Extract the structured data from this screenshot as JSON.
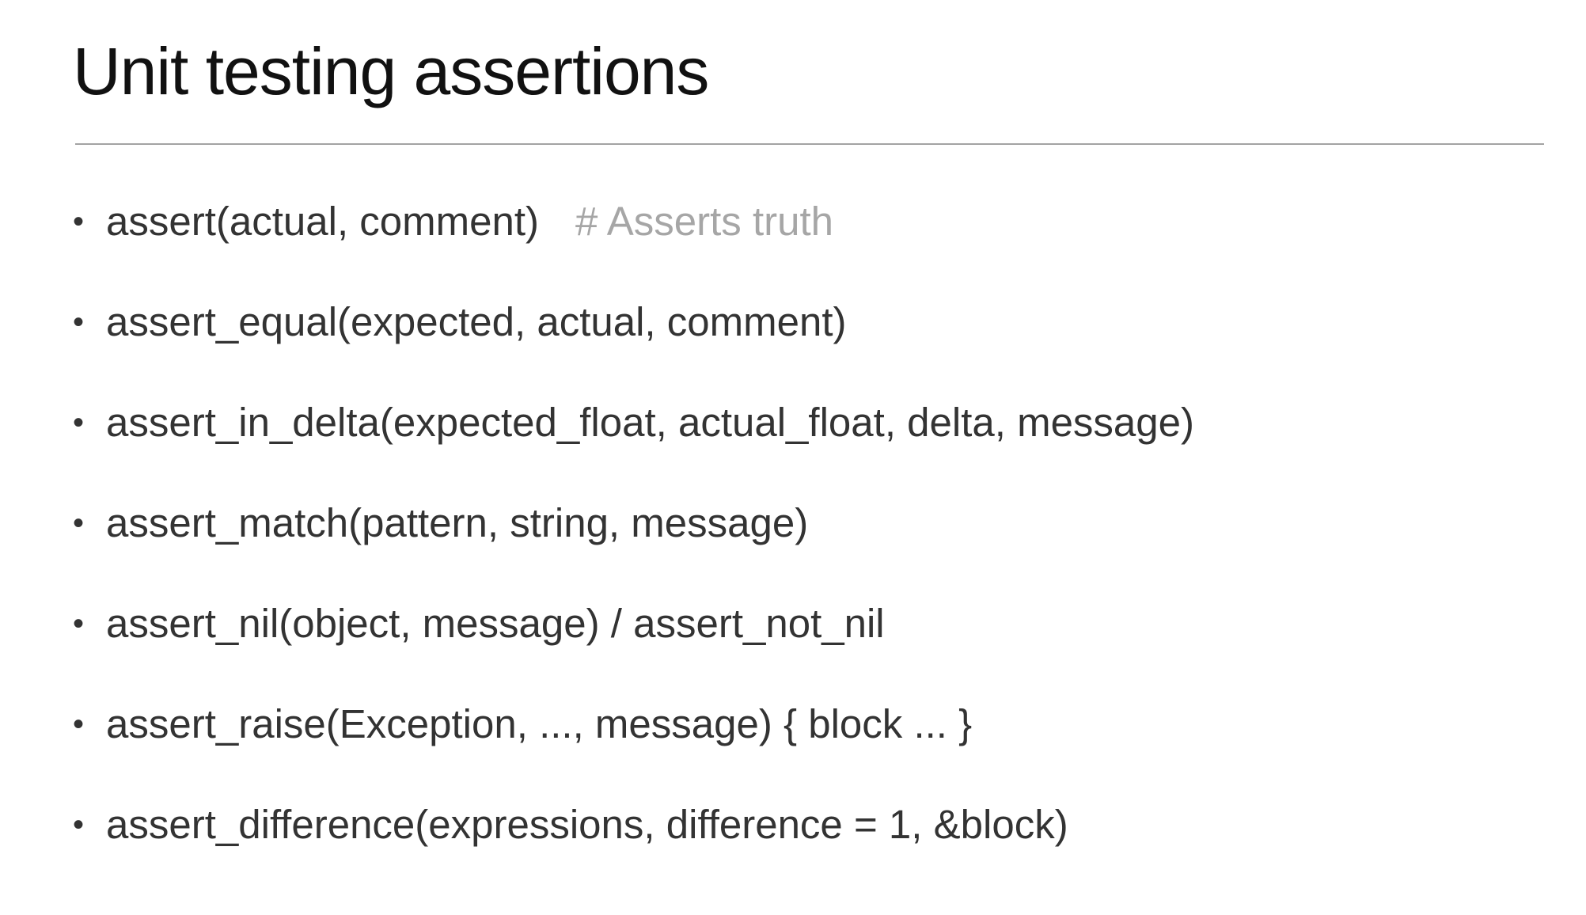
{
  "slide": {
    "title": "Unit testing assertions",
    "bullets": [
      {
        "text": "assert(actual, comment)",
        "comment": "# Asserts truth"
      },
      {
        "text": "assert_equal(expected, actual, comment)"
      },
      {
        "text": "assert_in_delta(expected_float, actual_float, delta, message)"
      },
      {
        "text": "assert_match(pattern, string, message)"
      },
      {
        "text": "assert_nil(object, message) / assert_not_nil"
      },
      {
        "text": "assert_raise(Exception, ..., message) { block ... }"
      },
      {
        "text": "assert_difference(expressions, difference = 1, &block)"
      }
    ],
    "bullet_glyph": "•"
  },
  "colors": {
    "text": "#333333",
    "title": "#111111",
    "comment": "#a6a6a6",
    "rule": "#a3a3a3",
    "background": "#ffffff"
  }
}
